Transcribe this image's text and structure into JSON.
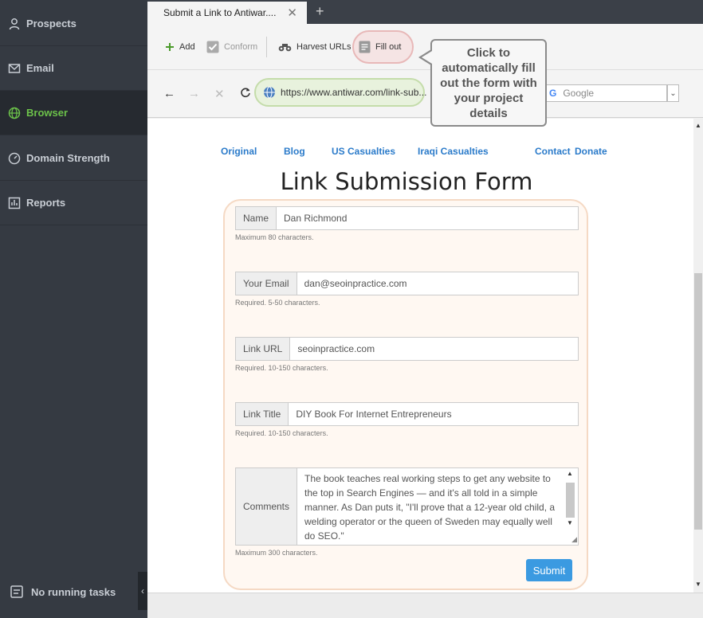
{
  "sidebar": {
    "items": [
      {
        "label": "Prospects",
        "icon": "user-icon"
      },
      {
        "label": "Email",
        "icon": "mail-icon"
      },
      {
        "label": "Browser",
        "icon": "globe-icon",
        "active": true
      },
      {
        "label": "Domain Strength",
        "icon": "gauge-icon"
      },
      {
        "label": "Reports",
        "icon": "report-icon"
      }
    ],
    "tasks_label": "No running tasks",
    "collapse_glyph": "‹"
  },
  "colors": {
    "accent_green": "#6cc24a",
    "link_blue": "#2b7bca",
    "submit_blue": "#3b9ae1",
    "sidebar_bg": "#353a42"
  },
  "tabs": [
    {
      "label": "Submit a Link to Antiwar....",
      "close": "✕"
    }
  ],
  "tab_add": "+",
  "toolbar": {
    "add_label": "Add",
    "conform_label": "Conform",
    "harvest_label": "Harvest URLs",
    "fillout_label": "Fill out"
  },
  "address": {
    "url": "https://www.antiwar.com/link-sub...",
    "search_placeholder": "Google",
    "search_logo": "G",
    "dropdown_glyph": "⌄",
    "back_glyph": "←",
    "forward_glyph": "→",
    "stop_glyph": "✕"
  },
  "callout": {
    "text": "Click to automatically fill out the form with your project details"
  },
  "page": {
    "nav": [
      "Original",
      "Blog",
      "US Casualties",
      "Iraqi Casualties",
      "Contact",
      "Donate"
    ],
    "title": "Link Submission Form",
    "fields": {
      "name": {
        "label": "Name",
        "value": "Dan Richmond",
        "hint": "Maximum 80 characters."
      },
      "email": {
        "label": "Your Email",
        "value": "dan@seoinpractice.com",
        "hint": "Required. 5-50 characters."
      },
      "url": {
        "label": "Link URL",
        "value": "seoinpractice.com",
        "hint": "Required. 10-150 characters."
      },
      "title": {
        "label": "Link Title",
        "value": "DIY Book For Internet Entrepreneurs",
        "hint": "Required. 10-150 characters."
      },
      "comments": {
        "label": "Comments",
        "value": "The book teaches real working steps to get any website to the top in Search Engines — and it's all told in a simple manner. As Dan puts it, \"I'll prove that a 12-year old child, a welding operator or the queen of Sweden may equally well do SEO.\"",
        "hint": "Maximum 300 characters."
      }
    },
    "submit_label": "Submit"
  }
}
